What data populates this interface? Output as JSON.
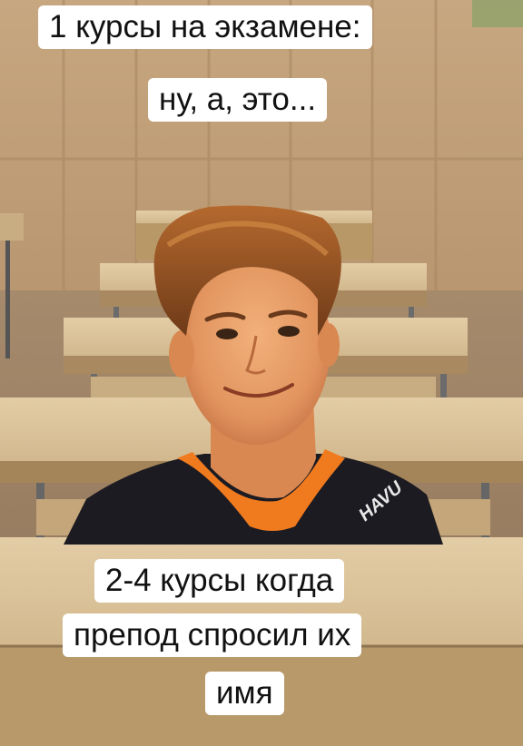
{
  "meme": {
    "top_caption": {
      "line1": "1 курсы на экзамене:",
      "line2": "ну, а, это..."
    },
    "bottom_caption": {
      "line1": "2-4 курсы когда",
      "line2": "препод спросил их",
      "line3": "имя"
    },
    "shirt_logo": "HAVU"
  }
}
